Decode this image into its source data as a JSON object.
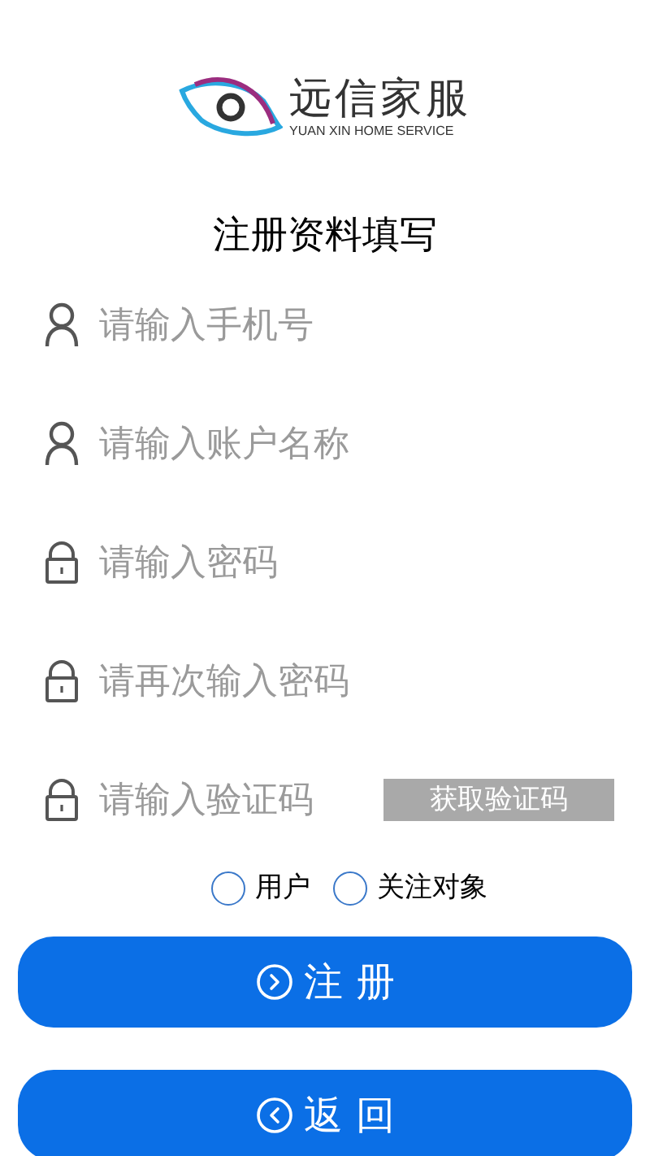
{
  "logo": {
    "name": "远信家服",
    "subtitle": "YUAN XIN HOME SERVICE"
  },
  "title": "注册资料填写",
  "fields": [
    {
      "kind": "user",
      "placeholder": "请输入手机号"
    },
    {
      "kind": "user",
      "placeholder": "请输入账户名称"
    },
    {
      "kind": "lock",
      "placeholder": "请输入密码"
    },
    {
      "kind": "lock",
      "placeholder": "请再次输入密码"
    },
    {
      "kind": "lock",
      "placeholder": "请输入验证码",
      "action": "获取验证码"
    }
  ],
  "roles": [
    {
      "label": "用户",
      "selected": false
    },
    {
      "label": "关注对象",
      "selected": false
    }
  ],
  "buttons": [
    {
      "kind": "next",
      "label": "注 册"
    },
    {
      "kind": "back",
      "label": "返 回"
    }
  ]
}
